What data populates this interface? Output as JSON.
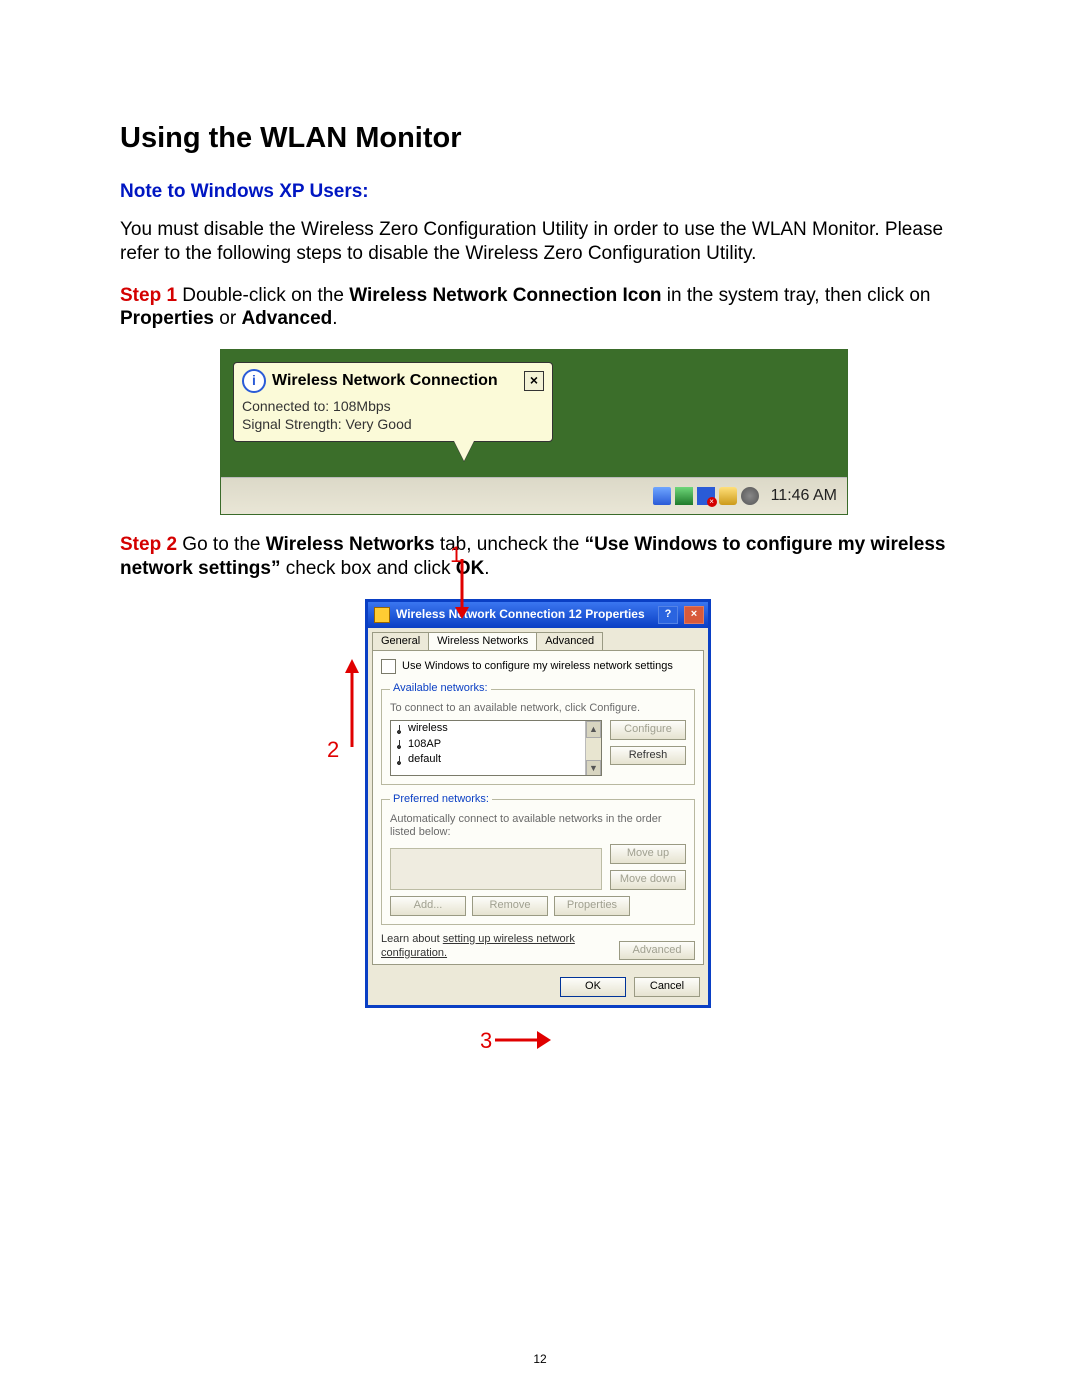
{
  "page_number": "12",
  "heading": "Using the WLAN Monitor",
  "subheading": "Note to Windows XP Users:",
  "intro": "You must disable the Wireless Zero Configuration Utility in order to use the WLAN Monitor. Please refer to the following steps to disable the Wireless Zero Configuration Utility.",
  "step1": {
    "label": "Step 1",
    "pre": " Double-click on the ",
    "bold1": "Wireless Network Connection Icon",
    "mid": " in the system tray, then click on ",
    "bold2": "Properties",
    "or": " or ",
    "bold3": "Advanced",
    "end": "."
  },
  "balloon": {
    "title": "Wireless Network Connection",
    "line1": "Connected to: 108Mbps",
    "line2": "Signal Strength: Very Good"
  },
  "taskbar": {
    "clock": "11:46 AM"
  },
  "step2": {
    "label": "Step 2",
    "pre": " Go to the ",
    "bold1": "Wireless Networks",
    "mid1": " tab, uncheck the ",
    "bold2": "“Use Windows to configure my wireless network settings”",
    "mid2": " check box and click ",
    "bold3": "OK",
    "end": "."
  },
  "callouts": {
    "c1": "1",
    "c2": "2",
    "c3": "3"
  },
  "dialog": {
    "title": "Wireless Network Connection 12 Properties",
    "tabs": {
      "general": "General",
      "wireless": "Wireless Networks",
      "advanced": "Advanced"
    },
    "checkbox_label": "Use Windows to configure my wireless network settings",
    "available": {
      "legend": "Available networks:",
      "hint": "To connect to an available network, click Configure.",
      "items": [
        "wireless",
        "108AP",
        "default"
      ],
      "btn_configure": "Configure",
      "btn_refresh": "Refresh"
    },
    "preferred": {
      "legend": "Preferred networks:",
      "hint": "Automatically connect to available networks in the order listed below:",
      "btn_moveup": "Move up",
      "btn_movedown": "Move down",
      "btn_add": "Add...",
      "btn_remove": "Remove",
      "btn_properties": "Properties"
    },
    "learn_pre": "Learn about ",
    "learn_link": "setting up wireless network configuration.",
    "btn_advanced": "Advanced",
    "btn_ok": "OK",
    "btn_cancel": "Cancel"
  }
}
